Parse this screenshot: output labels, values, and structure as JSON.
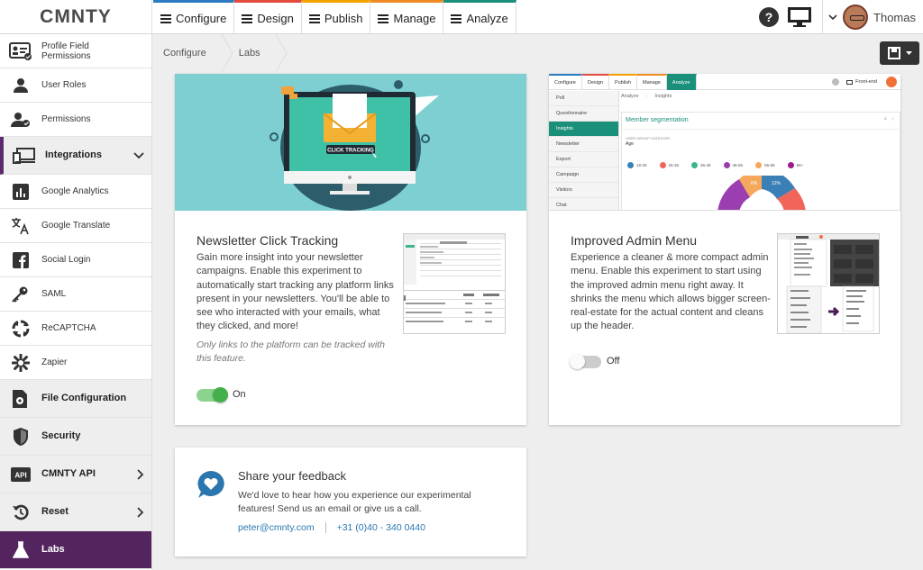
{
  "app": {
    "logo": "CMNTY"
  },
  "nav": {
    "tabs": [
      {
        "label": "Configure"
      },
      {
        "label": "Design"
      },
      {
        "label": "Publish"
      },
      {
        "label": "Manage"
      },
      {
        "label": "Analyze"
      }
    ]
  },
  "user": {
    "name": "Thomas",
    "help": "?"
  },
  "sidebar": {
    "items": [
      {
        "label": "Profile Field Permissions",
        "icon": "profile-card-icon"
      },
      {
        "label": "User Roles",
        "icon": "user-icon"
      },
      {
        "label": "Permissions",
        "icon": "user-check-icon"
      },
      {
        "label": "Integrations",
        "icon": "devices-icon"
      },
      {
        "label": "Google Analytics",
        "icon": "bar-chart-icon"
      },
      {
        "label": "Google Translate",
        "icon": "translate-icon"
      },
      {
        "label": "Social Login",
        "icon": "facebook-icon"
      },
      {
        "label": "SAML",
        "icon": "key-user-icon"
      },
      {
        "label": "ReCAPTCHA",
        "icon": "recaptcha-icon"
      },
      {
        "label": "Zapier",
        "icon": "asterisk-icon"
      },
      {
        "label": "File Configuration",
        "icon": "file-gear-icon"
      },
      {
        "label": "Security",
        "icon": "shield-icon"
      },
      {
        "label": "CMNTY API",
        "icon": "api-icon"
      },
      {
        "label": "Reset",
        "icon": "reset-icon"
      },
      {
        "label": "Labs",
        "icon": "flask-icon"
      }
    ]
  },
  "breadcrumb": {
    "items": [
      "Configure",
      "Labs"
    ]
  },
  "toolbar": {
    "save_icon": "save-icon"
  },
  "cards": {
    "newsletter": {
      "title": "Newsletter Click Tracking",
      "description": "Gain more insight into your newsletter campaigns. Enable this experiment to automatically start tracking any platform links present in your newsletters. You'll be able to see who interacted with your emails, what they clicked, and more!",
      "note": "Only links to the platform can be tracked with this feature.",
      "toggle_label": "On",
      "enabled": true,
      "hero_text": "CLICK TRACKING"
    },
    "admin_menu": {
      "title": "Improved Admin Menu",
      "description": "Experience a cleaner & more compact admin menu. Enable this experiment to start using the improved admin menu right away. It shrinks the menu which allows bigger screen-real-estate for the actual content and cleans up the header.",
      "toggle_label": "Off",
      "enabled": false,
      "preview": {
        "tabs": [
          "Configure",
          "Design",
          "Publish",
          "Manage",
          "Analyze"
        ],
        "front_end": "Front-end",
        "side_items": [
          "Poll",
          "Questionnaire",
          "Insights",
          "Newsletter",
          "Export",
          "Campaign",
          "Visitors",
          "Chat"
        ],
        "crumbs": [
          "Analyze",
          "Insights"
        ],
        "panel_title": "Member segmentation",
        "category_label": "USER GROUP CATEGORY",
        "category_value": "Age",
        "legend": [
          "18-25",
          "26-35",
          "36-45",
          "46-55",
          "56-65",
          "65+"
        ],
        "legend_colors": [
          "#3a7fb5",
          "#f0645a",
          "#3db38f",
          "#9b3fb0",
          "#f5a85c",
          "#9b1c8a"
        ],
        "pie_labels": [
          "6%",
          "12%"
        ]
      }
    },
    "feedback": {
      "title": "Share your feedback",
      "text": "We'd love to hear how you experience our experimental features! Send us an email or give us a call.",
      "email": "peter@cmnty.com",
      "phone": "+31 (0)40 - 340 0440"
    }
  },
  "colors": {
    "accent": "#54245f",
    "toggle_on": "#44b04b",
    "link": "#2a77b0",
    "hero_bg": "#7ecfd2",
    "analyze": "#1a8f7a"
  }
}
